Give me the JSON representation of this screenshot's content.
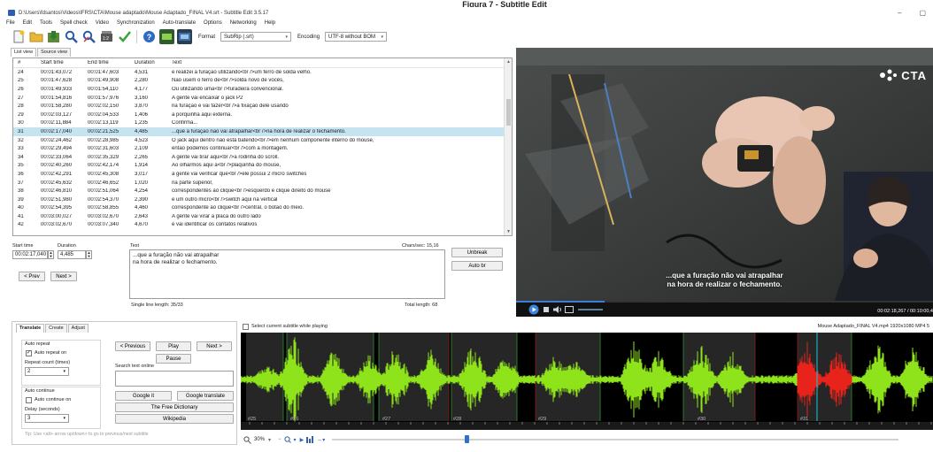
{
  "figure_caption": "Figura 7 - Subtitle Edit",
  "window": {
    "title": "D:\\Users\\fdsantos\\Videos\\IFRS\\CTA\\Mouse adaptado\\Mouse Adaptado_FINAL V4.srt - Subtitle Edit 3.5.17",
    "minimize": "–",
    "maximize": "▢"
  },
  "menu": [
    "File",
    "Edit",
    "Tools",
    "Spell check",
    "Video",
    "Synchronization",
    "Auto-translate",
    "Options",
    "Networking",
    "Help"
  ],
  "toolbar": {
    "format_label": "Format",
    "format_value": "SubRip (.srt)",
    "encoding_label": "Encoding",
    "encoding_value": "UTF-8 without BOM"
  },
  "view_tabs": [
    "List view",
    "Source view"
  ],
  "list": {
    "headers": [
      "#",
      "Start time",
      "End time",
      "Duration",
      "Text"
    ],
    "rows": [
      [
        "24",
        "00:01:43,072",
        "00:01:47,603",
        "4,531",
        "e realizei a furação utilizando<br />um ferro de solda velho."
      ],
      [
        "25",
        "00:01:47,628",
        "00:01:49,908",
        "2,280",
        "Não usem o ferro de<br />solda novo de vocês,"
      ],
      [
        "26",
        "00:01:49,933",
        "00:01:54,110",
        "4,177",
        "Ou utilizando uma<br />furadeira convencional."
      ],
      [
        "27",
        "00:01:54,816",
        "00:01:57,976",
        "3,160",
        "A gente vai encaixar o jack P2"
      ],
      [
        "28",
        "00:01:58,280",
        "00:02:02,150",
        "3,870",
        "na furação e vai fazer<br />a fixação dele usando"
      ],
      [
        "29",
        "00:02:03,127",
        "00:02:04,533",
        "1,406",
        "a porquinha aqui externa."
      ],
      [
        "30",
        "00:02:11,884",
        "00:02:13,119",
        "1,235",
        "Confirma..."
      ],
      [
        "31",
        "00:02:17,040",
        "00:02:21,525",
        "4,485",
        "...que a furação não vai atrapalhar<br />na hora de realizar o fechamento."
      ],
      [
        "32",
        "00:02:24,462",
        "00:02:28,985",
        "4,523",
        "O jack aqui dentro não está batendo<br />em nenhum componente interno do mouse,"
      ],
      [
        "33",
        "00:02:29,494",
        "00:02:31,603",
        "2,109",
        "então podemos continuar<br />com a montagem."
      ],
      [
        "34",
        "00:02:33,064",
        "00:02:35,329",
        "2,265",
        "A gente vai tirar aqui<br />a rodinha do scroll."
      ],
      [
        "35",
        "00:02:40,260",
        "00:02:42,174",
        "1,914",
        "Ao olharmos aqui a<br />plaquinha do mouse,"
      ],
      [
        "36",
        "00:02:42,291",
        "00:02:45,308",
        "3,017",
        "a gente vai verificar que<br />ele possui 2 micro switches"
      ],
      [
        "37",
        "00:02:45,632",
        "00:02:46,652",
        "1,020",
        "na parte superior,"
      ],
      [
        "38",
        "00:02:46,810",
        "00:02:51,064",
        "4,254",
        "correspondentes ao clique<br />esquerdo e clique direito do mouse"
      ],
      [
        "39",
        "00:02:51,980",
        "00:02:54,370",
        "2,390",
        "e um outro micro<br />switch aqui na vertical"
      ],
      [
        "40",
        "00:02:54,395",
        "00:02:58,855",
        "4,460",
        "correspondente ao clique<br />central, o botão do meio."
      ],
      [
        "41",
        "00:03:00,027",
        "00:03:02,670",
        "2,643",
        "A gente vai virar a placa do outro lado"
      ],
      [
        "42",
        "00:03:02,670",
        "00:03:07,340",
        "4,670",
        "e vai identificar os contatos relativos"
      ]
    ],
    "selected_index": 7
  },
  "edit": {
    "start_time_label": "Start time",
    "start_time": "00:02:17,040",
    "duration_label": "Duration",
    "duration": "4,485",
    "text_label": "Text",
    "text_line1": "...que a furação não vai atrapalhar",
    "text_line2": "na hora de realizar o fechamento.",
    "chars_sec": "Chars/sec: 15,16",
    "unbreak": "Unbreak",
    "auto_br": "Auto br",
    "prev": "< Prev",
    "next": "Next >",
    "single_line_length": "Single line length: 35/33",
    "total_length": "Total length: 68"
  },
  "video": {
    "subtitle_line1": "...que a furação não vai atrapalhar",
    "subtitle_line2": "na hora de realizar o fechamento.",
    "time": "00:02:18,267 / 00:10:00,4",
    "logo_text": "CTA"
  },
  "translate": {
    "tabs": [
      "Translate",
      "Create",
      "Adjust"
    ],
    "auto_repeat_title": "Auto repeat",
    "auto_repeat_on": "Auto repeat on",
    "repeat_count_label": "Repeat count (times)",
    "repeat_count_value": "2",
    "auto_continue_title": "Auto continue",
    "auto_continue_on": "Auto continue on",
    "delay_label": "Delay (seconds)",
    "delay_value": "3",
    "prev_btn": "< Previous",
    "play_btn": "Play",
    "next_btn": "Next >",
    "pause_btn": "Pause",
    "search_label": "Search text online",
    "google_it": "Google it",
    "google_translate": "Google translate",
    "free_dictionary": "The Free Dictionary",
    "wikipedia": "Wikipedia",
    "tip": "Tip: Use <alt+ arrow up/down> to go to previous/next subtitle"
  },
  "waveform": {
    "select_current": "Select current subtitle while playing",
    "file_info": "Mouse Adaptado_FINAL V4.mp4 1920x1080 MP4 5",
    "zoom": "30%",
    "markers": [
      "#25",
      "#26",
      "#27",
      "#28",
      "#29",
      "#30",
      "#31"
    ],
    "wave_color": "#8fe31a",
    "selected_color": "#e8231b"
  }
}
